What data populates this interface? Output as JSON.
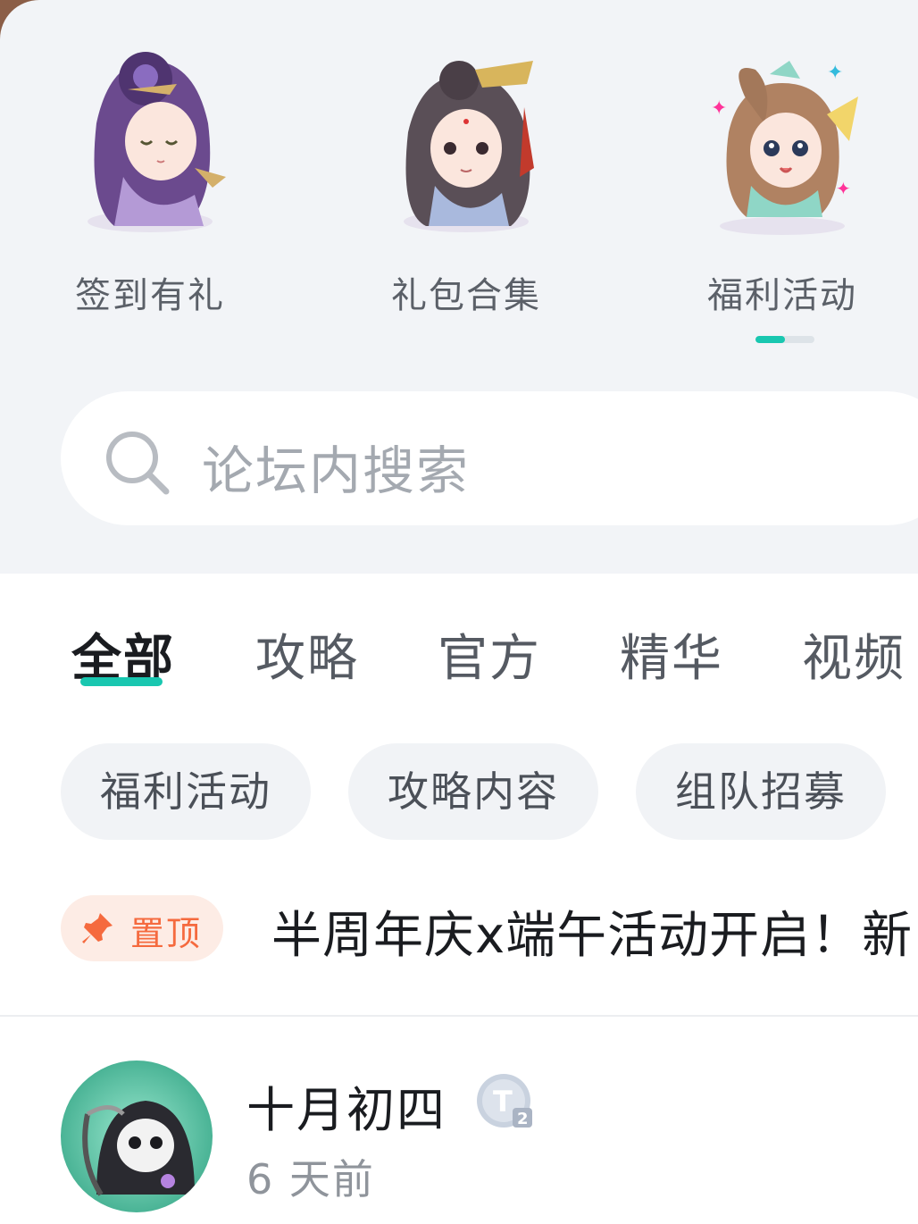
{
  "shortcuts": [
    {
      "label": "签到有礼",
      "icon": "purple-hair-character-icon"
    },
    {
      "label": "礼包合集",
      "icon": "dark-hair-character-icon"
    },
    {
      "label": "福利活动",
      "icon": "fan-girl-character-icon"
    }
  ],
  "shortcut_scroll": {
    "position": 0.5,
    "color": "#19c7b0"
  },
  "search": {
    "placeholder": "论坛内搜索",
    "icon": "search-icon"
  },
  "tabs": [
    {
      "label": "全部",
      "active": true
    },
    {
      "label": "攻略",
      "active": false
    },
    {
      "label": "官方",
      "active": false
    },
    {
      "label": "精华",
      "active": false
    },
    {
      "label": "视频",
      "active": false
    }
  ],
  "chips": [
    {
      "label": "福利活动"
    },
    {
      "label": "攻略内容"
    },
    {
      "label": "组队招募"
    }
  ],
  "pinned": {
    "badge": "置顶",
    "title": "半周年庆x端午活动开启！新"
  },
  "post": {
    "username": "十月初四",
    "level_badge": "T",
    "level_sub": "2",
    "time": "6 天前"
  },
  "colors": {
    "accent": "#19c7b0",
    "pin": "#f56a3e",
    "pin_bg": "#fdece5"
  }
}
